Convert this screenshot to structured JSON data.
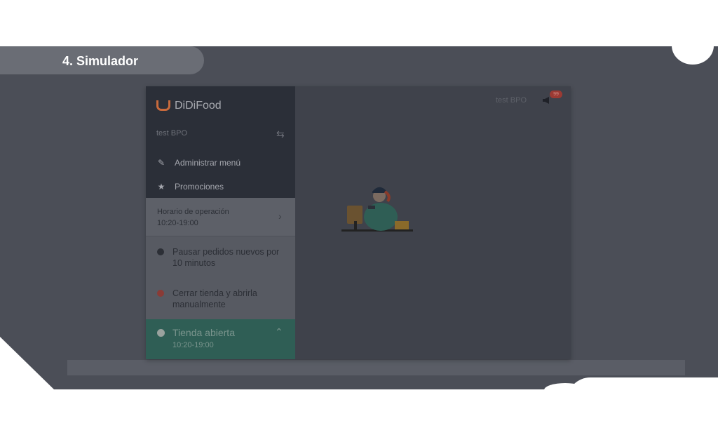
{
  "slide": {
    "title": "4. Simulador"
  },
  "app": {
    "brand": "DiDiFood",
    "store_name": "test BPO",
    "menu": [
      {
        "label": "Administrar menú",
        "icon": "pencil-icon"
      },
      {
        "label": "Promociones",
        "icon": "star-icon"
      }
    ],
    "hours": {
      "label": "Horario de operación",
      "time": "10:20-19:00"
    },
    "options": [
      {
        "label": "Pausar pedidos nuevos por 10 minutos",
        "color": "#2c2f36"
      },
      {
        "label": "Cerrar tienda y abrirla manualmente",
        "color": "#8a3b36"
      }
    ],
    "status": {
      "label": "Tienda abierta",
      "time": "10:20-19:00"
    },
    "header": {
      "user": "test BPO",
      "notification_count": "99"
    },
    "colors": {
      "accent": "#c86a3c",
      "open_green": "#2f5e55"
    }
  }
}
